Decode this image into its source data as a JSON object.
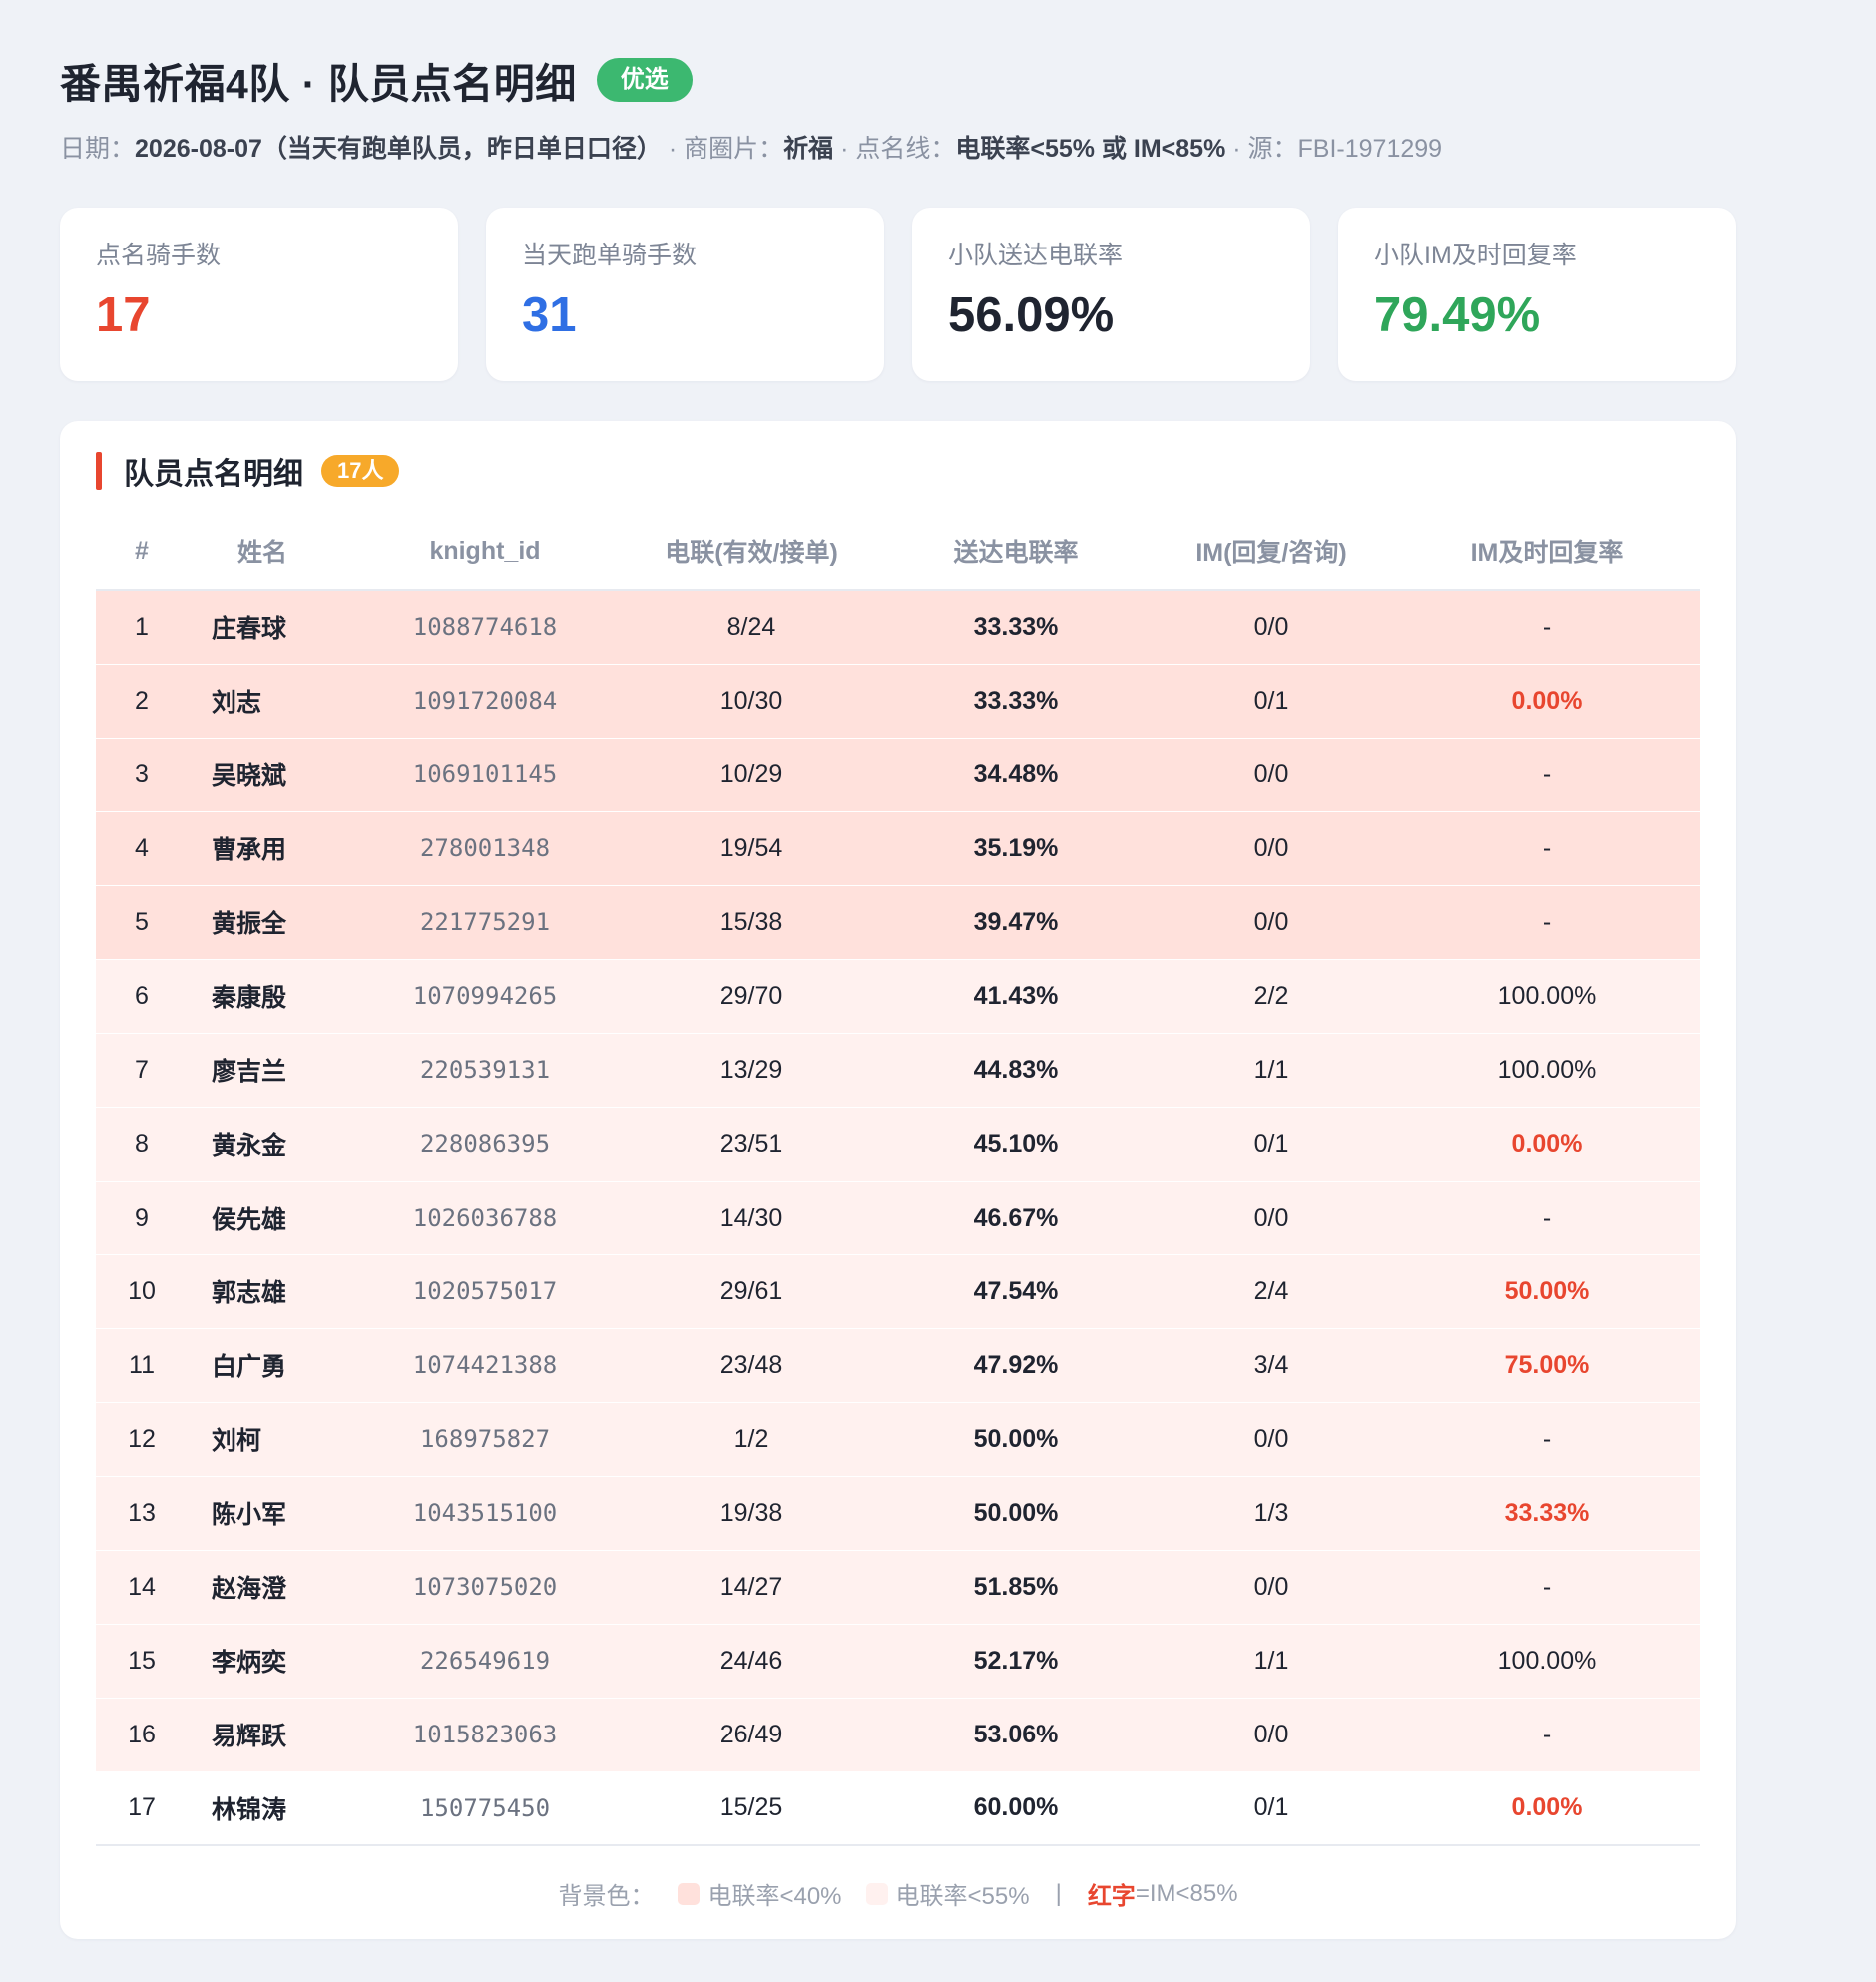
{
  "header": {
    "title": "番禺祈福4队 · 队员点名明细",
    "tag": "优选",
    "date_label": "日期：",
    "date_value": "2026-08-07（当天有跑单队员，昨日单日口径）",
    "area_label": " · 商圈片：",
    "area_value": "祈福",
    "line_label": " · 点名线：",
    "line_value": "电联率<55% 或 IM<85%",
    "source": " · 源：FBI-1971299"
  },
  "cards": [
    {
      "label": "点名骑手数",
      "value": "17",
      "color": "#e8462f"
    },
    {
      "label": "当天跑单骑手数",
      "value": "31",
      "color": "#2f6fe4"
    },
    {
      "label": "小队送达电联率",
      "value": "56.09%",
      "color": "#1f2430"
    },
    {
      "label": "小队IM及时回复率",
      "value": "79.49%",
      "color": "#2fa65a"
    }
  ],
  "panel": {
    "title": "队员点名明细",
    "count": "17人"
  },
  "table": {
    "headers": [
      "#",
      "姓名",
      "knight_id",
      "电联(有效/接单)",
      "送达电联率",
      "IM(回复/咨询)",
      "IM及时回复率"
    ],
    "rows": [
      {
        "no": "1",
        "name": "庄春球",
        "kid": "1088774618",
        "call": "8/24",
        "rate": "33.33%",
        "im": "0/0",
        "im_rate": "-",
        "level": 1,
        "red": false
      },
      {
        "no": "2",
        "name": "刘志",
        "kid": "1091720084",
        "call": "10/30",
        "rate": "33.33%",
        "im": "0/1",
        "im_rate": "0.00%",
        "level": 1,
        "red": true
      },
      {
        "no": "3",
        "name": "吴晓斌",
        "kid": "1069101145",
        "call": "10/29",
        "rate": "34.48%",
        "im": "0/0",
        "im_rate": "-",
        "level": 1,
        "red": false
      },
      {
        "no": "4",
        "name": "曹承用",
        "kid": "278001348",
        "call": "19/54",
        "rate": "35.19%",
        "im": "0/0",
        "im_rate": "-",
        "level": 1,
        "red": false
      },
      {
        "no": "5",
        "name": "黄振全",
        "kid": "221775291",
        "call": "15/38",
        "rate": "39.47%",
        "im": "0/0",
        "im_rate": "-",
        "level": 1,
        "red": false
      },
      {
        "no": "6",
        "name": "秦康殷",
        "kid": "1070994265",
        "call": "29/70",
        "rate": "41.43%",
        "im": "2/2",
        "im_rate": "100.00%",
        "level": 2,
        "red": false
      },
      {
        "no": "7",
        "name": "廖吉兰",
        "kid": "220539131",
        "call": "13/29",
        "rate": "44.83%",
        "im": "1/1",
        "im_rate": "100.00%",
        "level": 2,
        "red": false
      },
      {
        "no": "8",
        "name": "黄永金",
        "kid": "228086395",
        "call": "23/51",
        "rate": "45.10%",
        "im": "0/1",
        "im_rate": "0.00%",
        "level": 2,
        "red": true
      },
      {
        "no": "9",
        "name": "侯先雄",
        "kid": "1026036788",
        "call": "14/30",
        "rate": "46.67%",
        "im": "0/0",
        "im_rate": "-",
        "level": 2,
        "red": false
      },
      {
        "no": "10",
        "name": "郭志雄",
        "kid": "1020575017",
        "call": "29/61",
        "rate": "47.54%",
        "im": "2/4",
        "im_rate": "50.00%",
        "level": 2,
        "red": true
      },
      {
        "no": "11",
        "name": "白广勇",
        "kid": "1074421388",
        "call": "23/48",
        "rate": "47.92%",
        "im": "3/4",
        "im_rate": "75.00%",
        "level": 2,
        "red": true
      },
      {
        "no": "12",
        "name": "刘柯",
        "kid": "168975827",
        "call": "1/2",
        "rate": "50.00%",
        "im": "0/0",
        "im_rate": "-",
        "level": 2,
        "red": false
      },
      {
        "no": "13",
        "name": "陈小军",
        "kid": "1043515100",
        "call": "19/38",
        "rate": "50.00%",
        "im": "1/3",
        "im_rate": "33.33%",
        "level": 2,
        "red": true
      },
      {
        "no": "14",
        "name": "赵海澄",
        "kid": "1073075020",
        "call": "14/27",
        "rate": "51.85%",
        "im": "0/0",
        "im_rate": "-",
        "level": 2,
        "red": false
      },
      {
        "no": "15",
        "name": "李炳奕",
        "kid": "226549619",
        "call": "24/46",
        "rate": "52.17%",
        "im": "1/1",
        "im_rate": "100.00%",
        "level": 2,
        "red": false
      },
      {
        "no": "16",
        "name": "易辉跃",
        "kid": "1015823063",
        "call": "26/49",
        "rate": "53.06%",
        "im": "0/0",
        "im_rate": "-",
        "level": 2,
        "red": false
      },
      {
        "no": "17",
        "name": "林锦涛",
        "kid": "150775450",
        "call": "15/25",
        "rate": "60.00%",
        "im": "0/1",
        "im_rate": "0.00%",
        "level": 0,
        "red": true
      }
    ]
  },
  "legend": {
    "label": "背景色：",
    "item1": "电联率<40%",
    "item1_color": "#ffe1dc",
    "item2": "电联率<55%",
    "item2_color": "#fff1ef",
    "sep": "|",
    "red_text": "红字",
    "red_desc": "=IM<85%"
  }
}
